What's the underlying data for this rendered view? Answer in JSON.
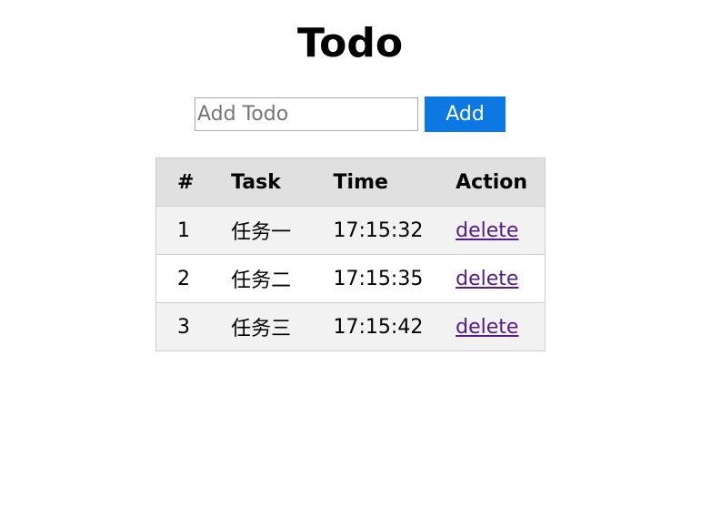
{
  "page": {
    "title": "Todo"
  },
  "form": {
    "input_placeholder": "Add Todo",
    "input_value": "",
    "add_label": "Add"
  },
  "table": {
    "headers": [
      "#",
      "Task",
      "Time",
      "Action"
    ],
    "rows": [
      {
        "num": "1",
        "task": "任务一",
        "time": "17:15:32",
        "action": "delete"
      },
      {
        "num": "2",
        "task": "任务二",
        "time": "17:15:35",
        "action": "delete"
      },
      {
        "num": "3",
        "task": "任务三",
        "time": "17:15:42",
        "action": "delete"
      }
    ]
  },
  "colors": {
    "accent": "#0b78e3",
    "link_visited": "#551a8b",
    "header_bg": "#e0e0e0",
    "stripe_bg": "#f2f2f2"
  }
}
